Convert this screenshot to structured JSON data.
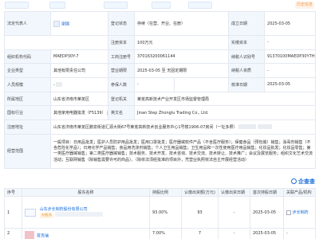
{
  "top_bar": {
    "history_label": "历史信息"
  },
  "info": {
    "legal_rep_label": "法定代表人",
    "legal_rep_name": "谢国",
    "reg_status_label": "登记状态",
    "reg_status_value": "存续（在营、开业、在册）",
    "est_date_label": "成立日期",
    "est_date_value": "2025-03-05",
    "reg_capital_label": "注册资本",
    "reg_capital_value": "100万元",
    "paid_capital_label": "实缴资本",
    "paid_capital_value": "-",
    "org_code_label": "组织机构代码",
    "org_code_value": "MAEDP30Y-7",
    "biz_reg_no_label": "工商注册号",
    "biz_reg_no_value": "370163200061144",
    "taxpayer_id_label": "纳税人识别号",
    "taxpayer_id_value": "91370100MAEDP30Y7H",
    "company_type_label": "企业类型",
    "company_type_value": "其他有限责任公司",
    "biz_term_label": "营业期限",
    "biz_term_value": "2025-03-05 至 无固定期限",
    "taxpayer_qual_label": "纳税人资质",
    "taxpayer_qual_value": "-",
    "staff_size_label": "人员规模",
    "staff_size_value": "-",
    "insured_label": "参保人数",
    "insured_value": "-",
    "approval_date_label": "核准日期",
    "approval_date_value": "2025-03-05",
    "region_label": "所属地区",
    "region_value": "山东省济南市莱芜区",
    "authority_label": "登记机关",
    "authority_value": "莱芜高新技术产业开发区市场监督管理局",
    "industry_label": "国标行业",
    "industry_value": "其他家用电器批发（F5139）",
    "english_label": "英文名",
    "english_value": "Jinan Step Zhonglu Trading Co., Ltd.",
    "address_label": "注册地址",
    "address_value": "山东省济南市莱芜区鹏泉街道汇源大街67号莱芜高新技术创业服务中心1号楼1906-07房间（一址多照）",
    "scope_label": "经营范围",
    "scope_value": "一般项目：日用品批发；医护人员防护用品批发；医用口罩批发；医疗器械软件产品（不含医疗服务）；保健食品（预包装）销售；消毒剂销售（不含危险化学品）；日用化学产品销售；食品用洗涤剂销售；个人卫生用品销售；卫生用品和一次性使用医疗用品销售；化妆品批发；化妆品零售；第一类医疗器械销售；第二类医疗器械销售；技术服务、技术开发、技术咨询、技术交流、技术转让、技术推广；会议及展览服务；组织文化艺术交流活动；互联网销售（除销售需要许可的商品）。（除依法须经批准的项目外，凭营业执照依法自主开展经营活动）"
  },
  "shareholders": {
    "headers": [
      "序号",
      "股东名称",
      "持股比例",
      "认缴出资额(万元)",
      "认缴出资日期",
      "首次持股日期",
      "关联产品/机构"
    ],
    "rows": [
      {
        "no": "1",
        "name": "山东步长制药股份有限公司",
        "tag": "大股东",
        "ratio": "93.00%",
        "amount": "93",
        "subscribe_date": "-",
        "first_hold_date": "2025-03-05",
        "related": "步长制药"
      },
      {
        "no": "2",
        "name": "蒋克瑞",
        "ratio": "7.00%",
        "amount": "7",
        "subscribe_date": "-",
        "first_hold_date": "2025-03-05",
        "related": "-"
      }
    ]
  },
  "brand": {
    "name": "企查查"
  }
}
